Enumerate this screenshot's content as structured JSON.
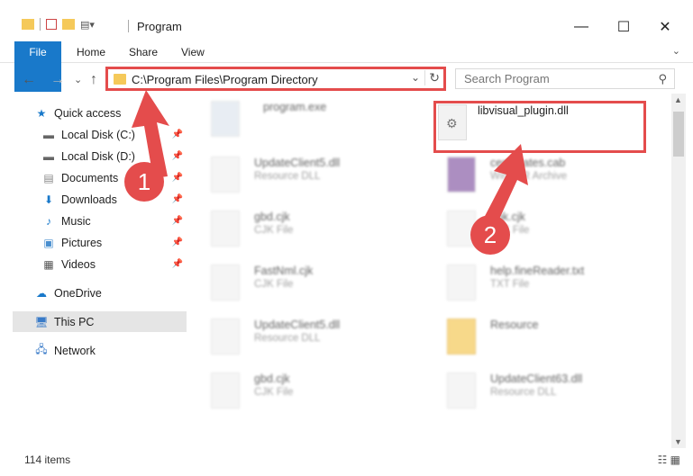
{
  "window": {
    "title": "Program",
    "minimize": "—",
    "maximize": "☐",
    "close": "✕"
  },
  "ribbon": {
    "tabs": [
      "File",
      "Home",
      "Share",
      "View"
    ],
    "expand": "⌄"
  },
  "address": {
    "path": "C:\\Program Files\\Program Directory",
    "dropdown": "⌄",
    "refresh": "↻"
  },
  "search": {
    "placeholder": "Search Program"
  },
  "nav": {
    "back": "←",
    "forward": "→",
    "recent": "⌄",
    "up": "↑",
    "items": [
      {
        "label": "Quick access",
        "icon": "star-icon"
      },
      {
        "label": "Local Disk (C:)",
        "icon": "drive-icon",
        "pinned": true
      },
      {
        "label": "Local Disk (D:)",
        "icon": "drive-icon",
        "pinned": true
      },
      {
        "label": "Documents",
        "icon": "documents-icon",
        "pinned": true
      },
      {
        "label": "Downloads",
        "icon": "download-icon",
        "pinned": true
      },
      {
        "label": "Music",
        "icon": "music-icon",
        "pinned": true
      },
      {
        "label": "Pictures",
        "icon": "pictures-icon",
        "pinned": true
      },
      {
        "label": "Videos",
        "icon": "videos-icon",
        "pinned": true
      },
      {
        "label": "OneDrive",
        "icon": "cloud-icon"
      },
      {
        "label": "This PC",
        "icon": "computer-icon",
        "selected": true
      },
      {
        "label": "Network",
        "icon": "network-icon"
      }
    ]
  },
  "files": [
    {
      "name": "program.exe",
      "type": ""
    },
    {
      "name": "libvisual_plugin.dll",
      "type": ""
    },
    {
      "name": "UpdateClient5.dll",
      "type": "Resource DLL"
    },
    {
      "name": "certificates.cab",
      "type": "WinRAR Archive"
    },
    {
      "name": "gbd.cjk",
      "type": "CJK File"
    },
    {
      "name": "gbk.cjk",
      "type": "CJK File"
    },
    {
      "name": "FastNml.cjk",
      "type": "CJK File"
    },
    {
      "name": "help.fineReader.txt",
      "type": "TXT File"
    },
    {
      "name": "UpdateClient5.dll",
      "type": "Resource DLL"
    },
    {
      "name": "Resource",
      "type": ""
    },
    {
      "name": "gbd.cjk",
      "type": "CJK File"
    },
    {
      "name": "UpdateClient63.dll",
      "type": "Resource DLL"
    }
  ],
  "status": {
    "count": "114 items"
  },
  "callouts": [
    "1",
    "2"
  ]
}
